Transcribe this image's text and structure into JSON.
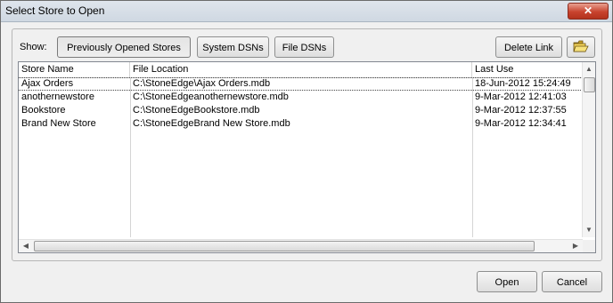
{
  "window": {
    "title": "Select Store to Open",
    "close_label": "✕"
  },
  "toolbar": {
    "show_label": "Show:",
    "previously_opened_label": "Previously Opened Stores",
    "system_dsns_label": "System DSNs",
    "file_dsns_label": "File DSNs",
    "delete_link_label": "Delete Link"
  },
  "list": {
    "columns": [
      "Store Name",
      "File Location",
      "Last Use"
    ],
    "rows": [
      {
        "name": "Ajax Orders",
        "location": "C:\\StoneEdge\\Ajax Orders.mdb",
        "last_use": "18-Jun-2012 15:24:49"
      },
      {
        "name": "anothernewstore",
        "location": "C:\\StoneEdgeanothernewstore.mdb",
        "last_use": "9-Mar-2012 12:41:03"
      },
      {
        "name": "Bookstore",
        "location": "C:\\StoneEdgeBookstore.mdb",
        "last_use": "9-Mar-2012 12:37:55"
      },
      {
        "name": "Brand New Store",
        "location": "C:\\StoneEdgeBrand New Store.mdb",
        "last_use": "9-Mar-2012 12:34:41"
      }
    ]
  },
  "footer": {
    "open_label": "Open",
    "cancel_label": "Cancel"
  },
  "icons": {
    "folder": "open-folder-icon"
  }
}
